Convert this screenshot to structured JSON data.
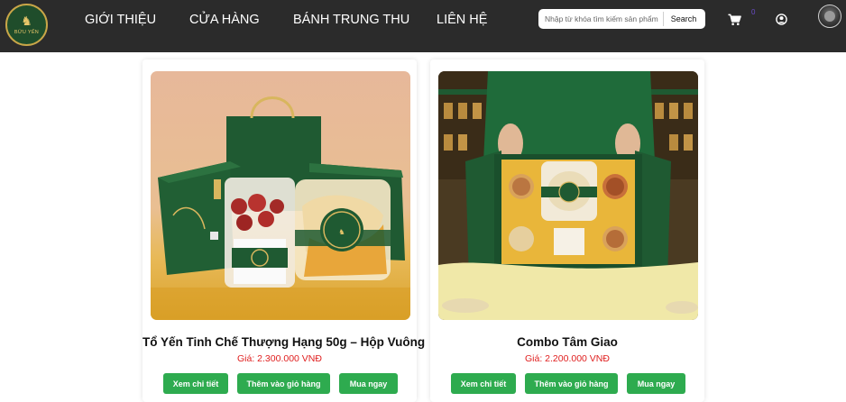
{
  "brand": {
    "logo_text": "BỬU YẾN"
  },
  "nav": {
    "items": [
      {
        "label": "GIỚI THIỆU"
      },
      {
        "label": "CỬA HÀNG"
      },
      {
        "label": "BÁNH TRUNG THU"
      },
      {
        "label": "LIÊN HỆ"
      }
    ]
  },
  "search": {
    "placeholder": "Nhập từ khóa tìm kiếm sản phẩm",
    "button_label": "Search"
  },
  "cart": {
    "count": "0",
    "icon": "cart-icon"
  },
  "user": {
    "icon": "user-icon"
  },
  "colors": {
    "nav_bg": "#2b2b2b",
    "button_green": "#2eab4f",
    "price_red": "#e02020",
    "product_green": "#1f5a32"
  },
  "products": [
    {
      "title": "Tổ Yến Tinh Chế Thượng Hạng 50g – Hộp Vuông",
      "price": "Giá: 2.300.000 VNĐ",
      "buttons": {
        "detail": "Xem chi tiết",
        "add_cart": "Thêm vào giỏ hàng",
        "buy": "Mua ngay"
      }
    },
    {
      "title": "Combo Tâm Giao",
      "price": "Giá: 2.200.000 VNĐ",
      "buttons": {
        "detail": "Xem chi tiết",
        "add_cart": "Thêm vào giỏ hàng",
        "buy": "Mua ngay"
      }
    }
  ]
}
